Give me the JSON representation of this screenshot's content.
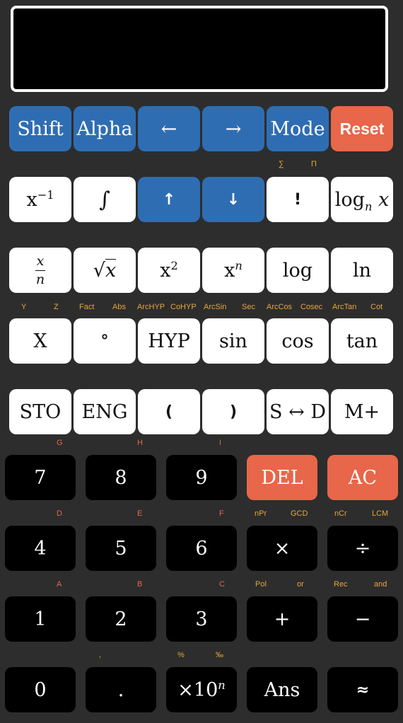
{
  "display": {
    "text": ""
  },
  "row1": {
    "shift": "Shift",
    "alpha": "Alpha",
    "left": "←",
    "right": "→",
    "mode": "Mode",
    "reset": "Reset"
  },
  "row1_sub": {
    "sum": "∑",
    "prod": "Π"
  },
  "row2": {
    "inverse_base": "x",
    "inverse_exp": "−1",
    "integral": "∫",
    "up": "↑",
    "down": "↓",
    "factorial": "!",
    "logn_base": "log",
    "logn_sub": "n",
    "logn_x": "x"
  },
  "row3": {
    "frac_num": "x",
    "frac_den": "n",
    "sqrt": "√",
    "sqrt_x": "x",
    "sq_base": "x",
    "sq_exp": "2",
    "pow_base": "x",
    "pow_exp": "n",
    "log": "log",
    "ln": "ln"
  },
  "row3_sub": [
    "Y",
    "Z",
    "Fact",
    "Abs",
    "ArcHYP",
    "CoHYP",
    "ArcSin",
    "Sec",
    "ArcCos",
    "Cosec",
    "ArcTan",
    "Cot"
  ],
  "row4": {
    "x": "X",
    "degree": "°",
    "hyp": "HYP",
    "sin": "sin",
    "cos": "cos",
    "tan": "tan"
  },
  "row5": {
    "sto": "STO",
    "eng": "ENG",
    "lparen": "(",
    "rparen": ")",
    "sd": "S ↔ D",
    "mplus": "M+"
  },
  "row5_sub": [
    "G",
    "H",
    "I"
  ],
  "row6": {
    "seven": "7",
    "eight": "8",
    "nine": "9",
    "del": "DEL",
    "ac": "AC"
  },
  "row6_sub": [
    "D",
    "E",
    "F",
    "nPr",
    "GCD",
    "nCr",
    "LCM"
  ],
  "row7": {
    "four": "4",
    "five": "5",
    "six": "6",
    "times": "×",
    "divide": "÷"
  },
  "row7_sub": [
    "A",
    "B",
    "C",
    "Pol",
    "or",
    "Rec",
    "and"
  ],
  "row8": {
    "one": "1",
    "two": "2",
    "three": "3",
    "plus": "+",
    "minus": "−"
  },
  "row8_sub": [
    ",",
    "%",
    "‰"
  ],
  "row9": {
    "zero": "0",
    "dot": ".",
    "exp_times": "×10",
    "exp_n": "n",
    "ans": "Ans",
    "approx": "≈"
  }
}
